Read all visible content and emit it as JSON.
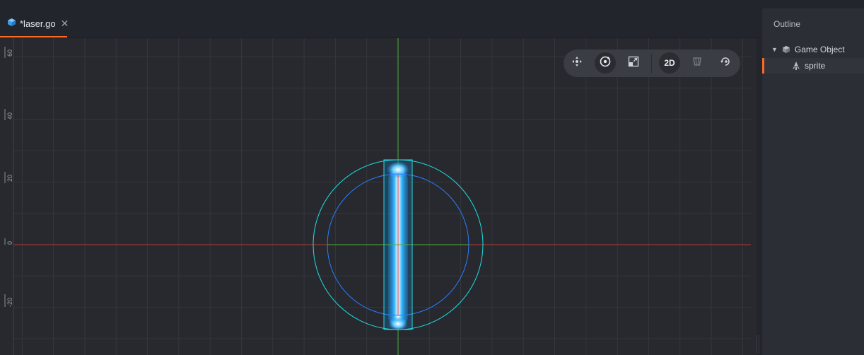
{
  "tab": {
    "title": "*laser.go",
    "close": "✕",
    "icon": "cube-icon",
    "accent": "#ff6a23"
  },
  "viewport": {
    "ruler_labels": [
      "60",
      "40",
      "20",
      "0",
      "-20"
    ],
    "colors": {
      "x_axis": "#c0392b",
      "y_axis": "#4caf3a",
      "grid": "#34373d",
      "selection": "#1fe0e0",
      "collision_circle": "#2a7dff"
    }
  },
  "toolbar": {
    "move_icon": "move-icon",
    "rotate_icon": "rotate-icon",
    "scale_icon": "scale-icon",
    "mode_2d": "2D",
    "visibility_icon": "visibility-filter-icon",
    "camera_icon": "camera-reset-icon"
  },
  "outline": {
    "title": "Outline",
    "items": [
      {
        "label": "Game Object",
        "icon": "cube-icon"
      },
      {
        "label": "sprite",
        "icon": "sprite-icon"
      }
    ]
  }
}
